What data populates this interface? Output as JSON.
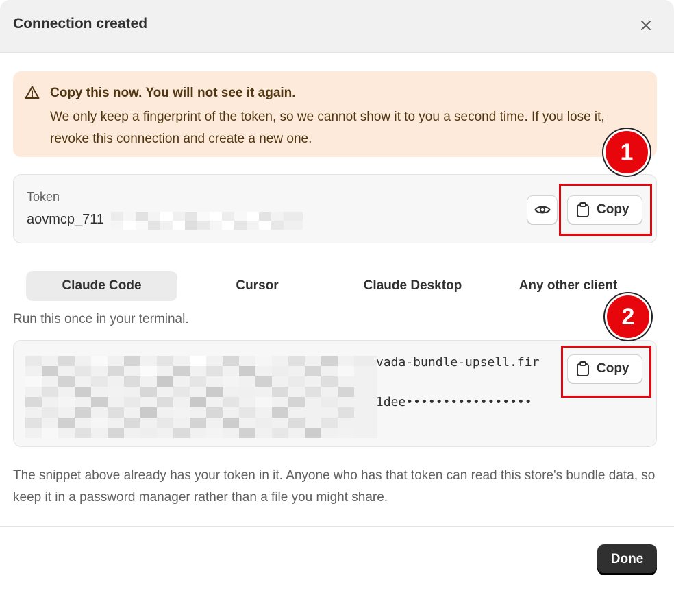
{
  "dialog": {
    "title": "Connection created",
    "close_icon": "close-icon"
  },
  "warning": {
    "icon": "warning-triangle-icon",
    "title": "Copy this now. You will not see it again.",
    "body": "We only keep a fingerprint of the token, so we cannot show it to you a second time. If you lose it, revoke this connection and create a new one.",
    "background": "#fdeadb",
    "text_color": "#4f3510"
  },
  "token": {
    "label": "Token",
    "value_prefix": "aovmcp_711",
    "reveal_icon": "eye-icon",
    "copy_label": "Copy",
    "copy_icon": "clipboard-icon"
  },
  "tabs": [
    {
      "label": "Claude Code",
      "active": true
    },
    {
      "label": "Cursor",
      "active": false
    },
    {
      "label": "Claude Desktop",
      "active": false
    },
    {
      "label": "Any other client",
      "active": false
    }
  ],
  "snippet": {
    "hint": "Run this once in your terminal.",
    "line1_tail": "vada-bundle-upsell.fir",
    "line2_tail": "1dee•••••••••••••••••",
    "copy_label": "Copy",
    "copy_icon": "clipboard-icon"
  },
  "footnote": "The snippet above already has your token in it. Anyone who has that token can read this store's bundle data, so keep it in a password manager rather than a file you might share.",
  "annotations": [
    {
      "number": "1",
      "color": "#e8060d"
    },
    {
      "number": "2",
      "color": "#e8060d"
    }
  ],
  "footer": {
    "done_label": "Done"
  }
}
